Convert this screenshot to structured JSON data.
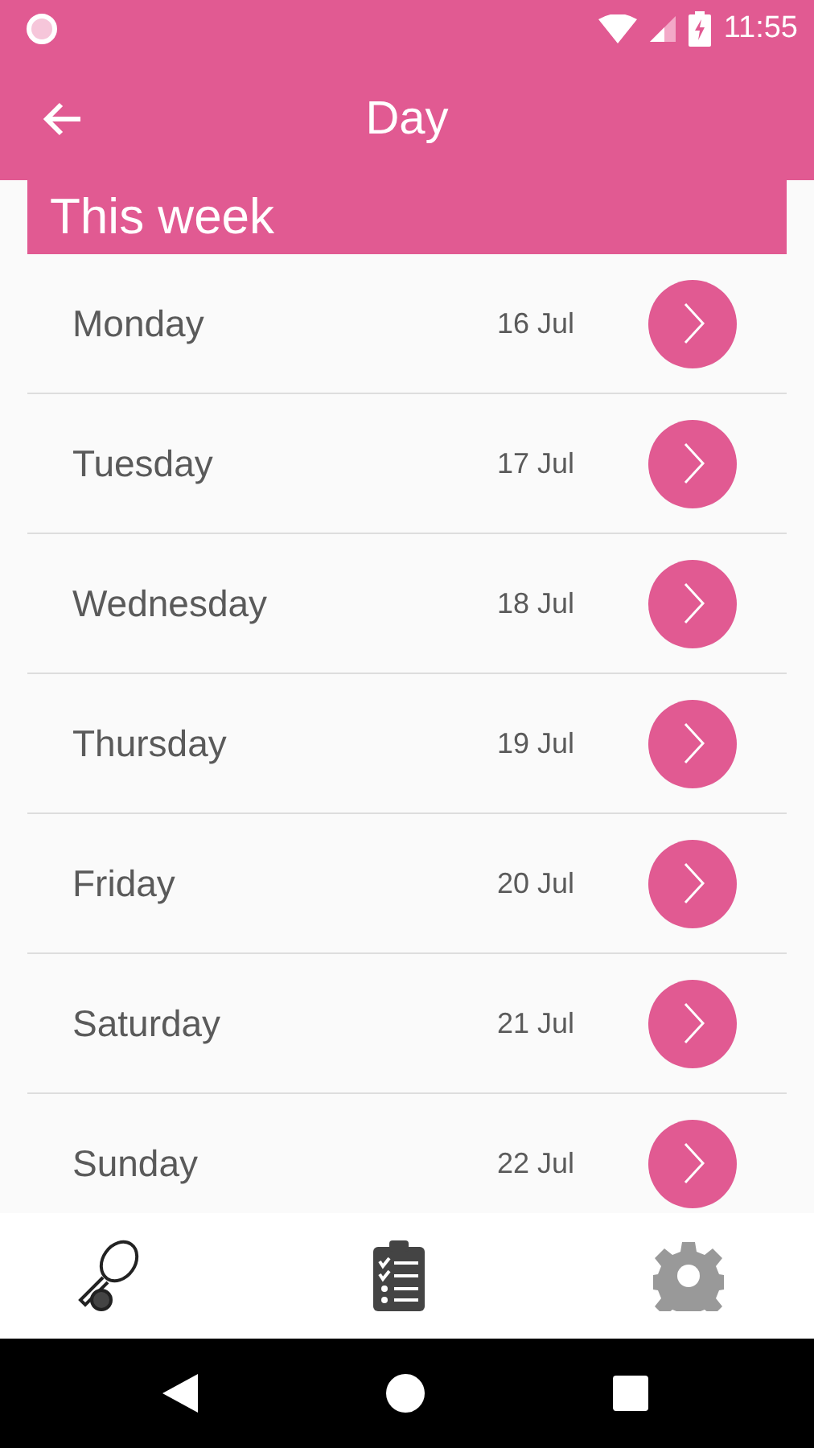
{
  "status_bar": {
    "time": "11:55"
  },
  "app_bar": {
    "title": "Day"
  },
  "section": {
    "title": "This week"
  },
  "days": [
    {
      "name": "Monday",
      "date": "16 Jul"
    },
    {
      "name": "Tuesday",
      "date": "17 Jul"
    },
    {
      "name": "Wednesday",
      "date": "18 Jul"
    },
    {
      "name": "Thursday",
      "date": "19 Jul"
    },
    {
      "name": "Friday",
      "date": "20 Jul"
    },
    {
      "name": "Saturday",
      "date": "21 Jul"
    },
    {
      "name": "Sunday",
      "date": "22 Jul"
    }
  ]
}
